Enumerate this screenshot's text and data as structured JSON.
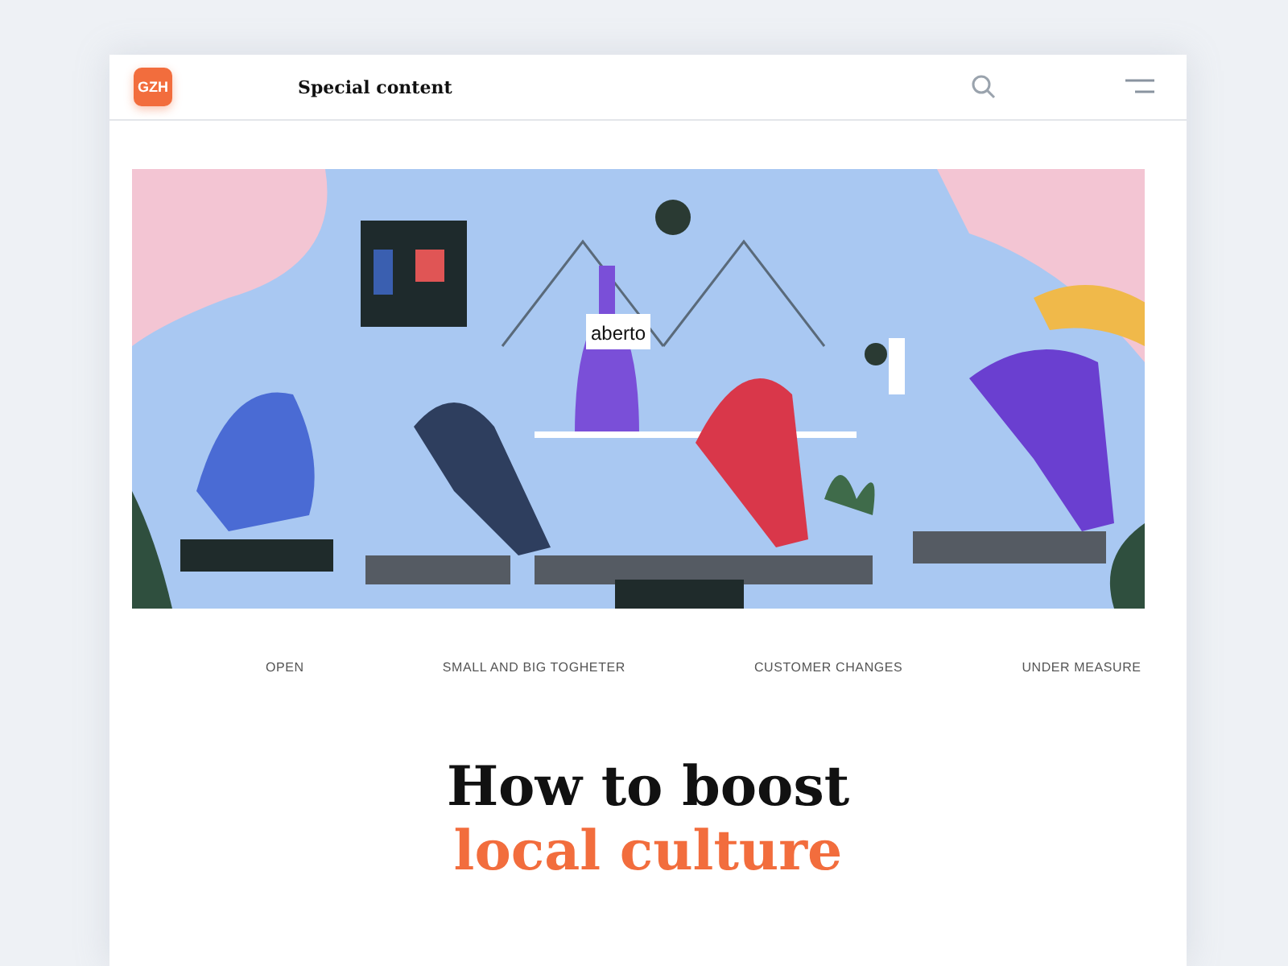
{
  "header": {
    "logo": "GZH",
    "title": "Special content"
  },
  "illustration": {
    "sign": "aberto"
  },
  "nav": [
    {
      "label": "OPEN"
    },
    {
      "label": "SMALL AND BIG TOGHETER"
    },
    {
      "label": "CUSTOMER CHANGES"
    },
    {
      "label": "UNDER MEASURE"
    }
  ],
  "headline": {
    "line_1": "How to boost",
    "line_2": "local culture"
  }
}
